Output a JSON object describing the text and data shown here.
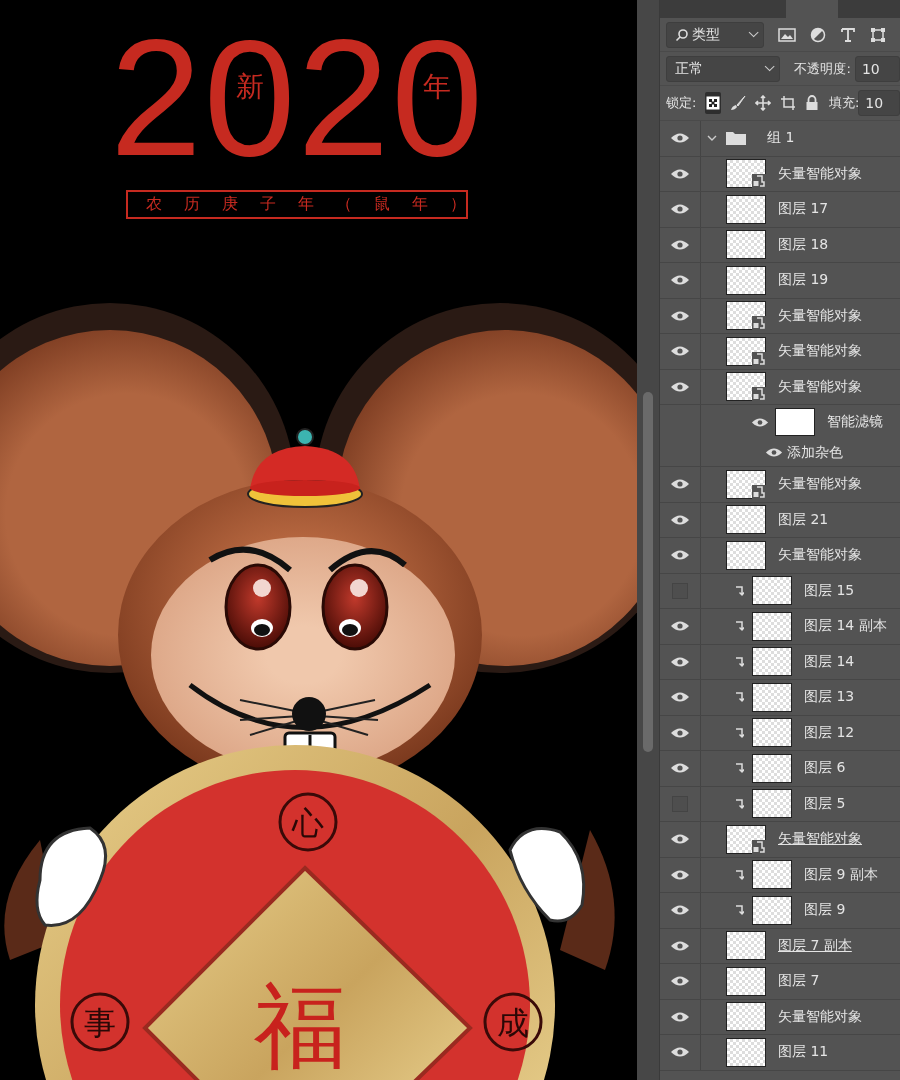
{
  "artwork": {
    "year": [
      {
        "digit": "2"
      },
      {
        "digit": "0",
        "inside": "新"
      },
      {
        "digit": "2"
      },
      {
        "digit": "0",
        "inside": "年"
      }
    ],
    "subtitle": "农历庚子年（鼠年）",
    "coin_chars": [
      {
        "text": "心",
        "kind": "small"
      },
      {
        "text": "事",
        "kind": "small"
      },
      {
        "text": "福",
        "kind": "big"
      },
      {
        "text": "成",
        "kind": "small"
      }
    ]
  },
  "layers_panel": {
    "filter": {
      "label": "类型"
    },
    "blend_mode": "正常",
    "opacity_label": "不透明度:",
    "opacity_value": "10",
    "lock_label": "锁定:",
    "locks": [
      {
        "kind": "transparency",
        "selected": true
      },
      {
        "kind": "brush",
        "selected": false
      },
      {
        "kind": "move",
        "selected": false
      },
      {
        "kind": "artboard",
        "selected": false
      },
      {
        "kind": "padlock",
        "selected": false
      }
    ],
    "fill_label": "填充:",
    "fill_value": "10",
    "group": {
      "name": "组 1",
      "visible": true,
      "expanded": true,
      "children": [
        {
          "name": "矢量智能对象",
          "visible": true,
          "clipped": false,
          "kind": "smart",
          "underlined": false
        },
        {
          "name": "图层 17",
          "visible": true,
          "clipped": false,
          "kind": "layer",
          "underlined": false
        },
        {
          "name": "图层 18",
          "visible": true,
          "clipped": false,
          "kind": "layer",
          "underlined": false
        },
        {
          "name": "图层 19",
          "visible": true,
          "clipped": false,
          "kind": "layer",
          "underlined": false
        },
        {
          "name": "矢量智能对象",
          "visible": true,
          "clipped": false,
          "kind": "smart",
          "underlined": false
        },
        {
          "name": "矢量智能对象",
          "visible": true,
          "clipped": false,
          "kind": "smart",
          "underlined": false
        },
        {
          "name": "矢量智能对象",
          "visible": true,
          "clipped": false,
          "kind": "smart",
          "underlined": false,
          "smart_filters": {
            "name": "智能滤镜",
            "visible": true,
            "children": [
              {
                "name": "添加杂色",
                "visible": true
              }
            ]
          }
        },
        {
          "name": "矢量智能对象",
          "visible": true,
          "clipped": false,
          "kind": "smart",
          "underlined": false
        },
        {
          "name": "图层 21",
          "visible": true,
          "clipped": false,
          "kind": "layer",
          "underlined": false
        },
        {
          "name": "矢量智能对象",
          "visible": true,
          "clipped": false,
          "kind": "layer",
          "underlined": false
        },
        {
          "name": "图层 15",
          "visible": false,
          "clipped": true,
          "kind": "layer",
          "underlined": false
        },
        {
          "name": "图层 14 副本",
          "visible": true,
          "clipped": true,
          "kind": "layer",
          "underlined": false
        },
        {
          "name": "图层 14",
          "visible": true,
          "clipped": true,
          "kind": "layer",
          "underlined": false
        },
        {
          "name": "图层 13",
          "visible": true,
          "clipped": true,
          "kind": "layer",
          "underlined": false
        },
        {
          "name": "图层 12",
          "visible": true,
          "clipped": true,
          "kind": "layer",
          "underlined": false
        },
        {
          "name": "图层 6",
          "visible": true,
          "clipped": true,
          "kind": "layer",
          "underlined": false
        },
        {
          "name": "图层 5",
          "visible": false,
          "clipped": true,
          "kind": "layer",
          "underlined": false
        },
        {
          "name": "矢量智能对象",
          "visible": true,
          "clipped": false,
          "kind": "smart",
          "underlined": true
        },
        {
          "name": "图层 9 副本",
          "visible": true,
          "clipped": true,
          "kind": "layer",
          "underlined": false
        },
        {
          "name": "图层 9",
          "visible": true,
          "clipped": true,
          "kind": "layer",
          "underlined": false
        },
        {
          "name": "图层 7 副本",
          "visible": true,
          "clipped": false,
          "kind": "layer",
          "underlined": true
        },
        {
          "name": "图层 7",
          "visible": true,
          "clipped": false,
          "kind": "layer",
          "underlined": false
        },
        {
          "name": "矢量智能对象",
          "visible": true,
          "clipped": false,
          "kind": "layer",
          "underlined": false
        },
        {
          "name": "图层 11",
          "visible": true,
          "clipped": false,
          "kind": "layer",
          "underlined": false
        }
      ]
    }
  }
}
